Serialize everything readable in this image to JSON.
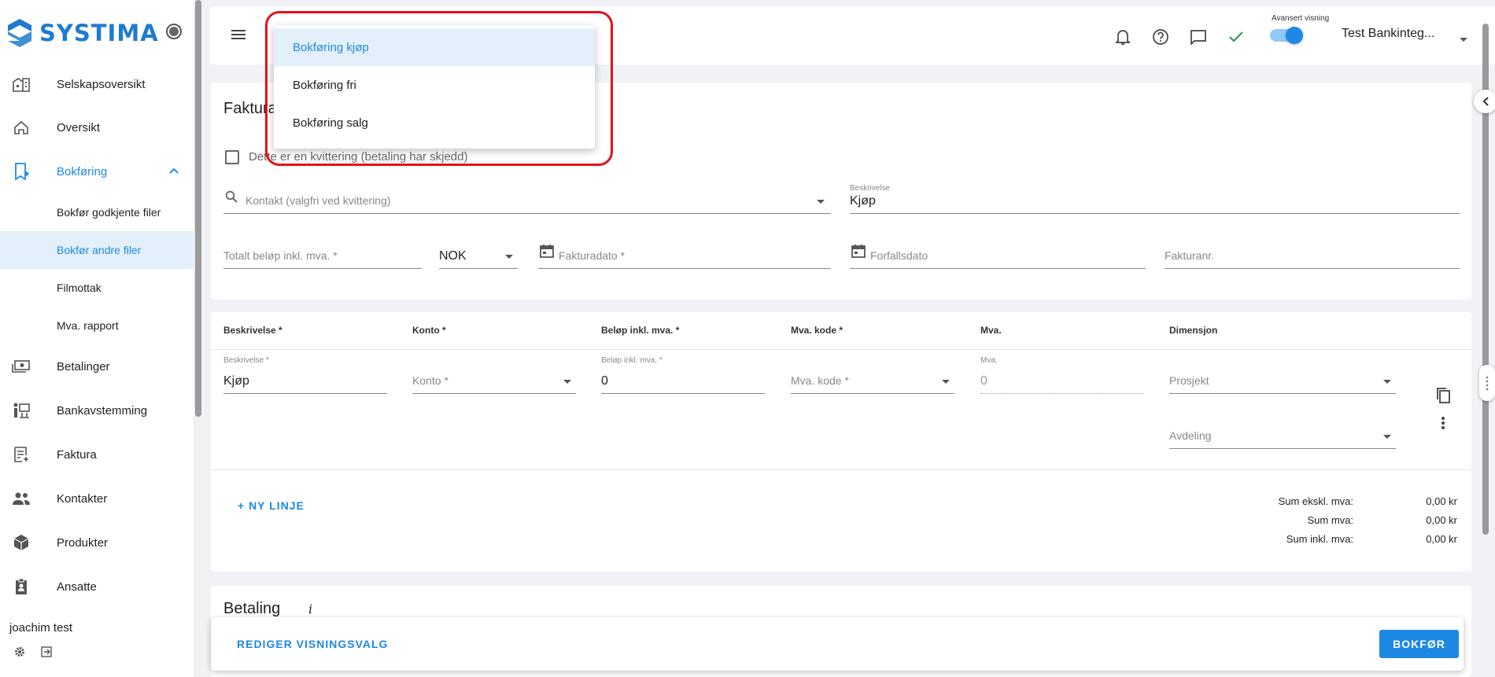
{
  "app": {
    "name": "SYSTIMA"
  },
  "sidebar": {
    "items": [
      {
        "label": "Selskapsoversikt",
        "icon": "company-overview-icon"
      },
      {
        "label": "Oversikt",
        "icon": "home-icon"
      },
      {
        "label": "Bokføring",
        "icon": "bookkeeping-icon",
        "active": true
      },
      {
        "label": "Betalinger",
        "icon": "payments-icon"
      },
      {
        "label": "Bankavstemming",
        "icon": "bank-reconciliation-icon"
      },
      {
        "label": "Faktura",
        "icon": "invoice-icon"
      },
      {
        "label": "Kontakter",
        "icon": "contacts-icon"
      },
      {
        "label": "Produkter",
        "icon": "products-icon"
      },
      {
        "label": "Ansatte",
        "icon": "employees-icon"
      }
    ],
    "subitems": [
      "Bokfør godkjente filer",
      "Bokfør andre filer",
      "Filmottak",
      "Mva. rapport"
    ],
    "selected_subitem": "Bokfør andre filer",
    "user_name": "joachim test"
  },
  "topbar": {
    "advanced_view_label": "Avansert visning",
    "advanced_view_on": true,
    "company_name": "Test Bankinteg..."
  },
  "dropdown": {
    "options": [
      "Bokføring kjøp",
      "Bokføring fri",
      "Bokføring salg"
    ],
    "selected": "Bokføring kjøp"
  },
  "invoice_card": {
    "title": "Fakturadetaljer",
    "title_visible": "Fakturad",
    "receipt_checkbox_label": "Dette er en kvittering (betaling har skjedd)",
    "receipt_checked": false,
    "contact_placeholder": "Kontakt (valgfri ved kvittering)",
    "description_label": "Beskrivelse",
    "description_value": "Kjøp",
    "total_placeholder": "Totalt beløp inkl. mva. *",
    "currency": "NOK",
    "invoice_date_placeholder": "Fakturadato *",
    "due_date_placeholder": "Forfallsdato",
    "invoice_no_placeholder": "Fakturanr."
  },
  "lines": {
    "headers": [
      "Beskrivelse *",
      "Konto *",
      "Beløp inkl. mva. *",
      "Mva. kode *",
      "Mva.",
      "Dimensjon"
    ],
    "row": {
      "description_label": "Beskrivelse *",
      "description_value": "Kjøp",
      "account_placeholder": "Konto *",
      "amount_label": "Beløp inkl. mva. *",
      "amount_value": "0",
      "vat_code_placeholder": "Mva. kode *",
      "vat_label": "Mva.",
      "vat_value": "0",
      "project_placeholder": "Prosjekt",
      "department_placeholder": "Avdeling"
    },
    "add_line_label": "+ NY LINJE",
    "sums": [
      {
        "label": "Sum ekskl. mva:",
        "value": "0,00 kr"
      },
      {
        "label": "Sum mva:",
        "value": "0,00 kr"
      },
      {
        "label": "Sum inkl. mva:",
        "value": "0,00 kr"
      }
    ]
  },
  "payment": {
    "title": "Betaling",
    "info": "i"
  },
  "bottom_bar": {
    "edit_view_label": "REDIGER VISNINGSVALG",
    "post_label": "BOKFØR"
  },
  "colors": {
    "accent": "#1e88e5",
    "highlight": "#e3f0fc",
    "annotation_red": "#e5101c"
  }
}
